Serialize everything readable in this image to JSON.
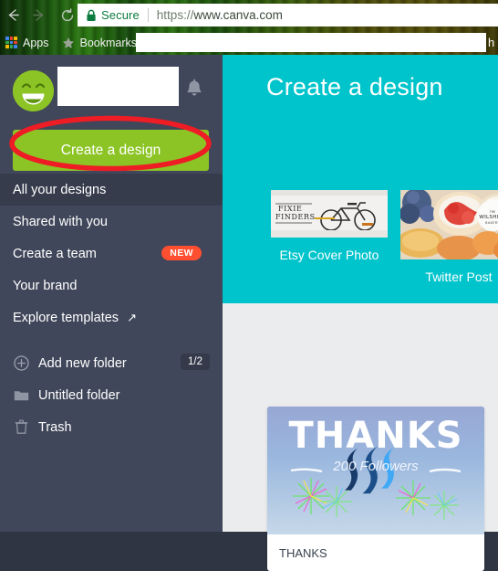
{
  "browser": {
    "back_icon": "back-arrow-icon",
    "forward_icon": "forward-arrow-icon",
    "reload_icon": "reload-icon",
    "secure_label": "Secure",
    "url_scheme": "https://",
    "url_host": "www.canva.com",
    "url_full": "https://www.canva.com",
    "bookmarks": {
      "apps_label": "Apps",
      "bookmarks_label": "Bookmarks",
      "overflow_text": "h"
    }
  },
  "sidebar": {
    "avatar_icon": "smiley-avatar-icon",
    "notification_icon": "bell-icon",
    "create_design_label": "Create a design",
    "nav_items": [
      {
        "label": "All your designs",
        "active": true
      },
      {
        "label": "Shared with you",
        "active": false
      },
      {
        "label": "Create a team",
        "active": false,
        "badge": "NEW"
      },
      {
        "label": "Your brand",
        "active": false
      },
      {
        "label": "Explore templates",
        "active": false,
        "external": "↗"
      }
    ],
    "folder_items": [
      {
        "label": "Add new folder",
        "icon": "plus-circle-icon",
        "count": "1/2"
      },
      {
        "label": "Untitled folder",
        "icon": "folder-icon"
      },
      {
        "label": "Trash",
        "icon": "trash-icon"
      }
    ]
  },
  "main": {
    "hero_title": "Create a design",
    "templates": [
      {
        "label": "Etsy Cover Photo",
        "thumb": "bicycle-fixie-finders-photo"
      },
      {
        "label": "Twitter Post",
        "thumb": "wilshire-bakery-pastries-photo"
      }
    ],
    "designs": [
      {
        "name": "THANKS",
        "headline": "THANKS",
        "subline": "200 Followers",
        "thumb": "steem-logo-fireworks-graphic"
      }
    ]
  },
  "annotation": {
    "shape": "red-ellipse-highlight",
    "target": "create-design-button",
    "color": "#ee1c25"
  },
  "colors": {
    "sidebar_bg": "#40475a",
    "sidebar_active": "#363c4c",
    "accent_teal": "#00c4cc",
    "cta_green": "#8cc425",
    "badge_orange": "#ff4f30",
    "content_bg": "#ebecee",
    "annotation_red": "#ee1c25"
  }
}
